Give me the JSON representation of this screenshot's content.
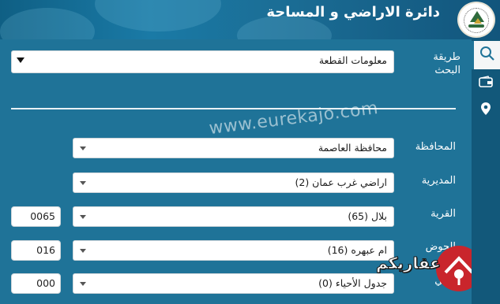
{
  "header": {
    "title": "دائرة الاراضي و المساحة"
  },
  "watermark": "www.eurekajo.com",
  "brand": {
    "name": "عقاريكم"
  },
  "rail": {
    "icons": [
      "search-icon",
      "wallet-icon",
      "location-pin-icon"
    ]
  },
  "search_method": {
    "label": "طريقة البحث",
    "value": "معلومات القطعة"
  },
  "fields": {
    "governorate": {
      "label": "المحافظة",
      "value": "محافظة العاصمة"
    },
    "directorate": {
      "label": "المديرية",
      "value": "اراضي غرب عمان (2)"
    },
    "village": {
      "label": "القرية",
      "value": "بلال (65)",
      "code": "0065"
    },
    "basin": {
      "label": "الحوض",
      "value": "ام عبهره (16)",
      "code": "016"
    },
    "neighborhood": {
      "label": "الحي",
      "value": "جدول الأحياء (0)",
      "code": "000"
    }
  },
  "colors": {
    "panel": "#1f7398",
    "header": "#12557c",
    "rail": "#12587a",
    "brand_red": "#c9252c"
  }
}
